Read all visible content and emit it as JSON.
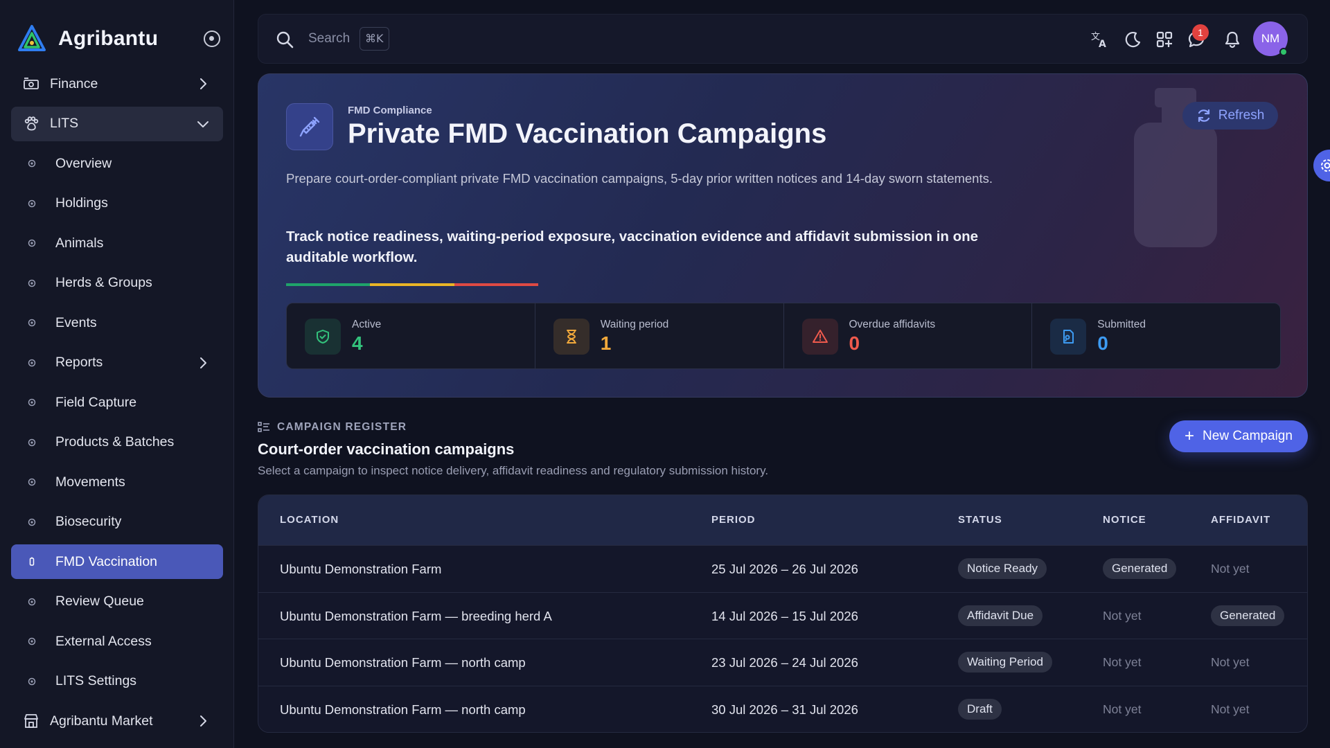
{
  "brand": {
    "name": "Agribantu"
  },
  "sidebar": {
    "items": [
      {
        "label": "Finance",
        "icon": "finance-icon",
        "type": "group",
        "chevron": "right"
      },
      {
        "label": "LITS",
        "icon": "paw-icon",
        "type": "group-open",
        "chevron": "down"
      },
      {
        "label": "Overview",
        "icon": "overview-icon",
        "type": "sub"
      },
      {
        "label": "Holdings",
        "icon": "holdings-icon",
        "type": "sub"
      },
      {
        "label": "Animals",
        "icon": "animals-icon",
        "type": "sub"
      },
      {
        "label": "Herds & Groups",
        "icon": "herds-icon",
        "type": "sub"
      },
      {
        "label": "Events",
        "icon": "events-icon",
        "type": "sub"
      },
      {
        "label": "Reports",
        "icon": "reports-icon",
        "type": "sub",
        "chevron": "right"
      },
      {
        "label": "Field Capture",
        "icon": "field-capture-icon",
        "type": "sub"
      },
      {
        "label": "Products & Batches",
        "icon": "products-icon",
        "type": "sub"
      },
      {
        "label": "Movements",
        "icon": "movements-icon",
        "type": "sub"
      },
      {
        "label": "Biosecurity",
        "icon": "biosecurity-icon",
        "type": "sub"
      },
      {
        "label": "FMD Vaccination",
        "icon": "vaccine-icon",
        "type": "sub-active"
      },
      {
        "label": "Review Queue",
        "icon": "review-icon",
        "type": "sub"
      },
      {
        "label": "External Access",
        "icon": "external-access-icon",
        "type": "sub"
      },
      {
        "label": "LITS Settings",
        "icon": "settings-icon",
        "type": "sub"
      },
      {
        "label": "Agribantu Market",
        "icon": "market-icon",
        "type": "group",
        "chevron": "right"
      }
    ]
  },
  "topbar": {
    "search_label": "Search",
    "search_shortcut": "⌘K",
    "notification_count": "1",
    "avatar_initials": "NM",
    "icons": [
      "translate-icon",
      "moon-icon",
      "apps-icon",
      "chat-icon",
      "bell-icon"
    ]
  },
  "hero": {
    "kicker": "FMD Compliance",
    "title": "Private FMD Vaccination Campaigns",
    "refresh_label": "Refresh",
    "description": "Prepare court-order-compliant private FMD vaccination campaigns, 5-day prior written notices and 14-day sworn statements.",
    "emphasis": "Track notice readiness, waiting-period exposure, vaccination evidence and affidavit submission in one auditable workflow.",
    "stripe_colors": [
      "#1fa36a",
      "#e9b526",
      "#df4a44"
    ],
    "stats": [
      {
        "label": "Active",
        "value": "4",
        "color": "#33c27c",
        "icon": "shield-icon"
      },
      {
        "label": "Waiting period",
        "value": "1",
        "color": "#f2a93b",
        "icon": "hourglass-icon"
      },
      {
        "label": "Overdue affidavits",
        "value": "0",
        "color": "#ef5a4d",
        "icon": "warning-icon"
      },
      {
        "label": "Submitted",
        "value": "0",
        "color": "#3d9bf2",
        "icon": "document-icon"
      }
    ]
  },
  "register": {
    "kicker": "CAMPAIGN REGISTER",
    "title": "Court-order vaccination campaigns",
    "subtitle": "Select a campaign to inspect notice delivery, affidavit readiness and regulatory submission history.",
    "new_button": "New Campaign",
    "columns": [
      "LOCATION",
      "PERIOD",
      "STATUS",
      "NOTICE",
      "AFFIDAVIT"
    ],
    "rows": [
      {
        "location": "Ubuntu Demonstration Farm",
        "period": "25 Jul 2026 – 26 Jul 2026",
        "status": "Notice Ready",
        "notice": "Generated",
        "affidavit": "Not yet"
      },
      {
        "location": "Ubuntu Demonstration Farm — breeding herd A",
        "period": "14 Jul 2026 – 15 Jul 2026",
        "status": "Affidavit Due",
        "notice": "Not yet",
        "affidavit": "Generated"
      },
      {
        "location": "Ubuntu Demonstration Farm — north camp",
        "period": "23 Jul 2026 – 24 Jul 2026",
        "status": "Waiting Period",
        "notice": "Not yet",
        "affidavit": "Not yet"
      },
      {
        "location": "Ubuntu Demonstration Farm — north camp",
        "period": "30 Jul 2026 – 31 Jul 2026",
        "status": "Draft",
        "notice": "Not yet",
        "affidavit": "Not yet"
      }
    ]
  }
}
